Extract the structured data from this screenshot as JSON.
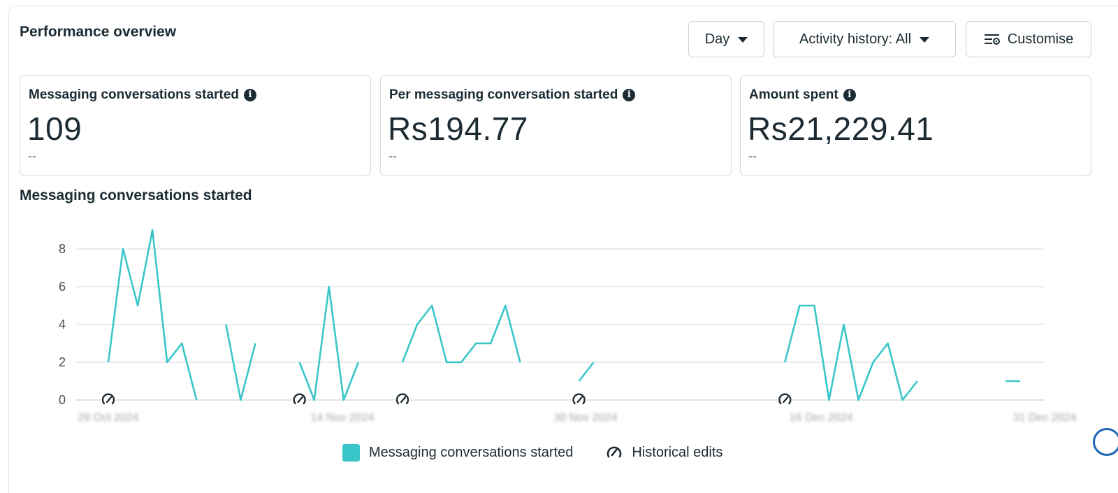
{
  "header": {
    "title": "Performance overview",
    "day_label": "Day",
    "activity_label": "Activity history: All",
    "customise_label": "Customise"
  },
  "cards": [
    {
      "label": "Messaging conversations started",
      "value": "109",
      "delta": "--"
    },
    {
      "label": "Per messaging conversation started",
      "value": "Rs194.77",
      "delta": "--"
    },
    {
      "label": "Amount spent",
      "value": "Rs21,229.41",
      "delta": "--"
    }
  ],
  "chart_title": "Messaging conversations started",
  "colors": {
    "series": "#3ac6c9",
    "grid": "#e4e6eb",
    "text": "#1c2b33"
  },
  "chart_data": {
    "type": "line",
    "y_ticks": [
      0,
      2,
      4,
      6,
      8
    ],
    "ylim": [
      0,
      9
    ],
    "x_tick_labels": [
      "29 Oct 2024",
      "14 Nov 2024",
      "30 Nov 2024",
      "16 Dec 2024",
      "31 Dec 2024"
    ],
    "x_labels_blurred": true,
    "grid": true,
    "legend_position": "bottom",
    "series": [
      {
        "name": "Messaging conversations started",
        "color": "#3ac6c9",
        "values": [
          2,
          8,
          5,
          9,
          2,
          3,
          0,
          null,
          4,
          0,
          3,
          null,
          null,
          2,
          0,
          6,
          0,
          2,
          null,
          null,
          2,
          4,
          5,
          2,
          2,
          3,
          3,
          5,
          2,
          null,
          null,
          null,
          1,
          2,
          null,
          null,
          null,
          null,
          null,
          null,
          null,
          null,
          null,
          null,
          null,
          null,
          2,
          5,
          5,
          0,
          4,
          0,
          2,
          3,
          0,
          1,
          null,
          null,
          null,
          null,
          null,
          1,
          1
        ]
      }
    ],
    "historical_edits": [
      0,
      13,
      20,
      32,
      46
    ],
    "legend": [
      "Messaging conversations started",
      "Historical edits"
    ]
  },
  "legend": {
    "series_label": "Messaging conversations started",
    "edits_label": "Historical edits"
  },
  "icons": {
    "info": "info-icon",
    "caret": "caret-down-icon",
    "customise": "sliders-settings-icon",
    "edit": "historical-edit-icon"
  }
}
